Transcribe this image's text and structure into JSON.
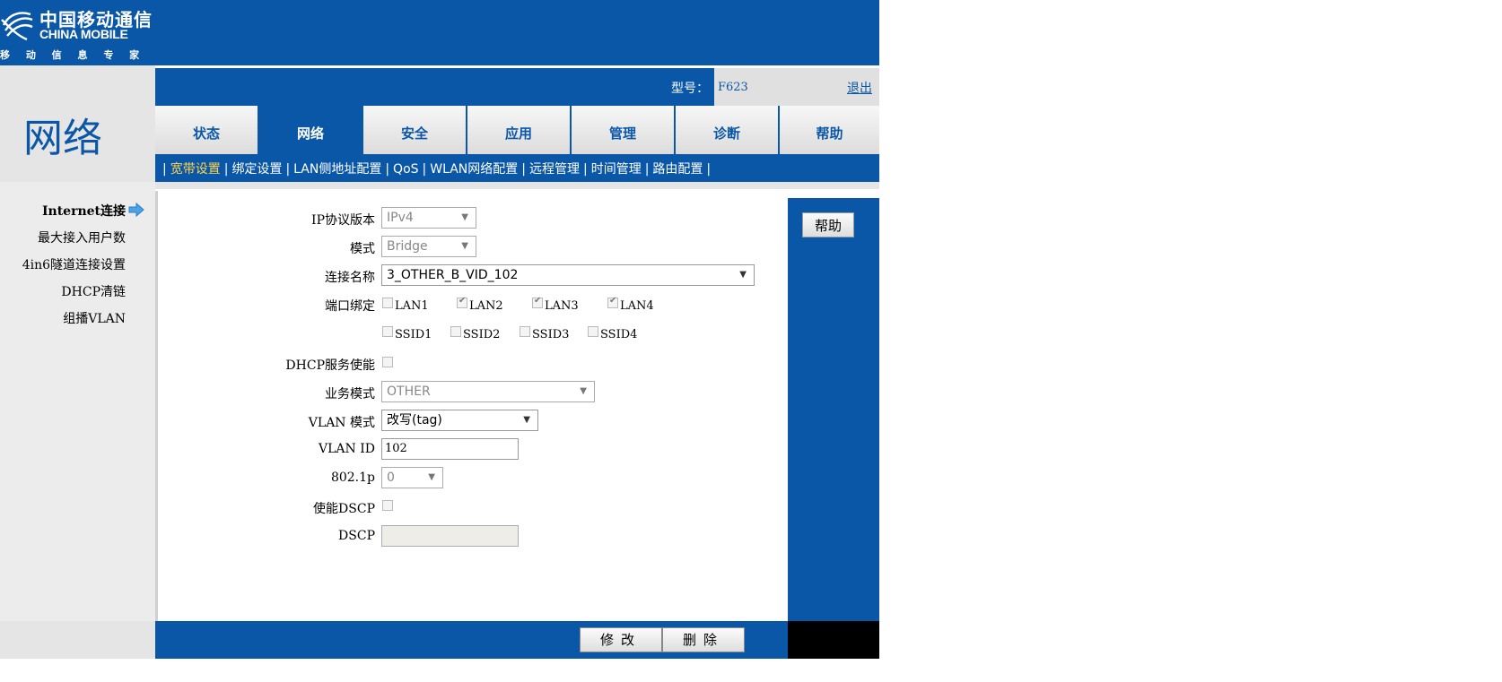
{
  "brand": {
    "name_cn": "中国移动通信",
    "name_en": "CHINA MOBILE",
    "slogan": "移 动 信 息 专 家"
  },
  "page_title": "网络",
  "model": {
    "label": "型号：",
    "value": "F623",
    "logout": "退出"
  },
  "tabs": [
    {
      "label": "状态",
      "active": false
    },
    {
      "label": "网络",
      "active": true
    },
    {
      "label": "安全",
      "active": false
    },
    {
      "label": "应用",
      "active": false
    },
    {
      "label": "管理",
      "active": false
    },
    {
      "label": "诊断",
      "active": false
    },
    {
      "label": "帮助",
      "active": false
    }
  ],
  "subnav": [
    {
      "label": "宽带设置",
      "active": true
    },
    {
      "label": "绑定设置",
      "active": false
    },
    {
      "label": "LAN侧地址配置",
      "active": false
    },
    {
      "label": "QoS",
      "active": false
    },
    {
      "label": "WLAN网络配置",
      "active": false
    },
    {
      "label": "远程管理",
      "active": false
    },
    {
      "label": "时间管理",
      "active": false
    },
    {
      "label": "路由配置",
      "active": false
    }
  ],
  "sidebar": [
    {
      "label": "Internet连接",
      "active": true
    },
    {
      "label": "最大接入用户数",
      "active": false
    },
    {
      "label": "4in6隧道连接设置",
      "active": false
    },
    {
      "label": "DHCP清链",
      "active": false
    },
    {
      "label": "组播VLAN",
      "active": false
    }
  ],
  "form": {
    "ip_version": {
      "label": "IP协议版本",
      "value": "IPv4"
    },
    "mode": {
      "label": "模式",
      "value": "Bridge"
    },
    "conn_name": {
      "label": "连接名称",
      "value": "3_OTHER_B_VID_102"
    },
    "port_bind": {
      "label": "端口绑定",
      "lan": [
        {
          "name": "LAN1",
          "checked": false
        },
        {
          "name": "LAN2",
          "checked": true
        },
        {
          "name": "LAN3",
          "checked": true
        },
        {
          "name": "LAN4",
          "checked": true
        }
      ],
      "ssid": [
        {
          "name": "SSID1",
          "checked": false
        },
        {
          "name": "SSID2",
          "checked": false
        },
        {
          "name": "SSID3",
          "checked": false
        },
        {
          "name": "SSID4",
          "checked": false
        }
      ]
    },
    "dhcp_enable": {
      "label": "DHCP服务使能"
    },
    "service_mode": {
      "label": "业务模式",
      "value": "OTHER"
    },
    "vlan_mode": {
      "label": "VLAN 模式",
      "value": "改写(tag)"
    },
    "vlan_id": {
      "label": "VLAN ID",
      "value": "102"
    },
    "p8021": {
      "label": "802.1p",
      "value": "0"
    },
    "dscp_enable": {
      "label": "使能DSCP"
    },
    "dscp": {
      "label": "DSCP",
      "value": ""
    }
  },
  "help_button": "帮助",
  "actions": {
    "modify": "修改",
    "delete": "删除"
  },
  "colors": {
    "brand_blue": "#0a57a8",
    "active_sub": "#ffd54a"
  }
}
